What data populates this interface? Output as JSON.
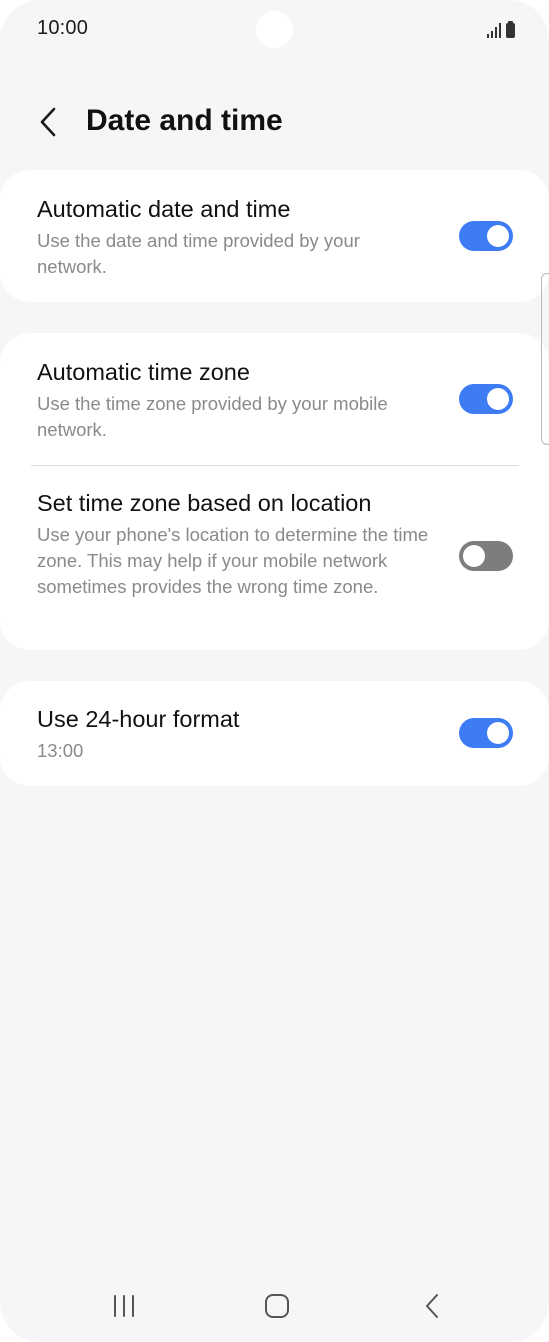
{
  "status_bar": {
    "time": "10:00"
  },
  "header": {
    "title": "Date and time",
    "back_icon": "chevron-left-icon"
  },
  "settings": {
    "automatic_date_time": {
      "title": "Automatic date and time",
      "subtitle": "Use the date and time provided by your network.",
      "enabled": true
    },
    "automatic_time_zone": {
      "title": "Automatic time zone",
      "subtitle": "Use the time zone provided by your mobile network.",
      "enabled": true
    },
    "location_time_zone": {
      "title": "Set time zone based on location",
      "subtitle": "Use your phone's location to determine the time zone. This may help if your mobile network sometimes provides the wrong time zone.",
      "enabled": false
    },
    "hour_format_24": {
      "title": "Use 24-hour format",
      "subtitle": "13:00",
      "enabled": true
    }
  },
  "colors": {
    "toggle_on": "#3e7cf5",
    "toggle_off": "#7d7d80",
    "background": "#f6f6f8",
    "card": "#ffffff"
  },
  "nav_bar": {
    "recents_icon": "recents-icon",
    "home_icon": "home-icon",
    "back_icon": "back-icon"
  }
}
